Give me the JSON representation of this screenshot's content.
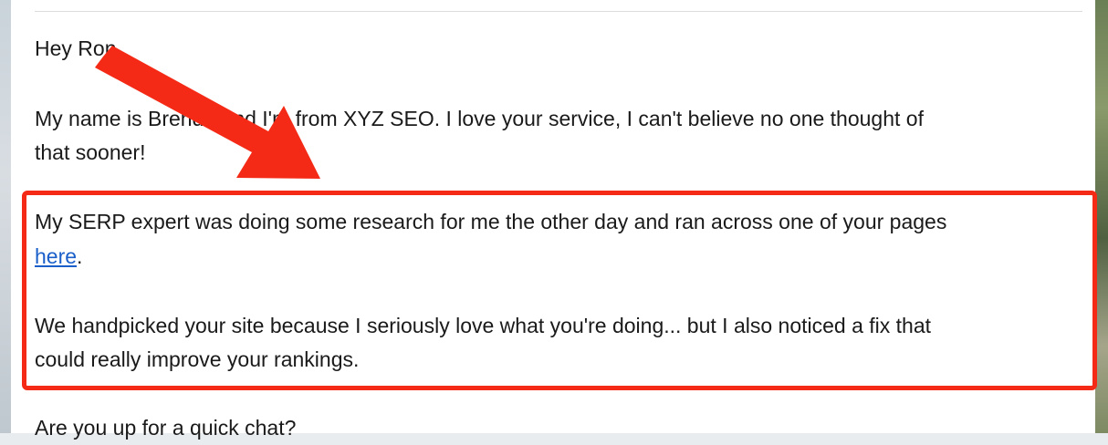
{
  "email": {
    "greeting": "Hey Ron,",
    "paragraph1": {
      "line1": "My name is Brenda and I'm from XYZ SEO. I love your service, I can't believe no one thought of",
      "line2": "that sooner!"
    },
    "paragraph2": {
      "line1": "My SERP expert was doing some research for me the other day and ran across one of your pages",
      "link_text": "here",
      "after_link": "."
    },
    "paragraph3": {
      "line1": "We handpicked your site because I seriously love what you're doing... but I also noticed a fix that",
      "line2": "could really improve your rankings."
    },
    "closing_question": "Are you up for a quick chat?"
  },
  "annotation": {
    "highlight_color": "#f42a16",
    "arrow_color": "#f42a16"
  },
  "colors": {
    "link": "#1a5fc9",
    "text": "#1a1a1a"
  }
}
